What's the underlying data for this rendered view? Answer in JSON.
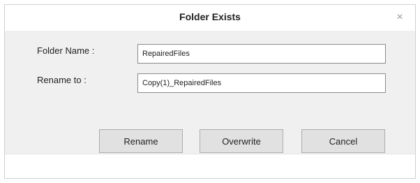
{
  "dialog": {
    "title": "Folder Exists",
    "close_icon": "close-icon",
    "close_glyph": "×"
  },
  "form": {
    "folder_name_label": "Folder Name :",
    "folder_name_value": "RepairedFiles",
    "rename_to_label": "Rename to :",
    "rename_to_value": "Copy(1)_RepairedFiles"
  },
  "buttons": {
    "rename": "Rename",
    "overwrite": "Overwrite",
    "cancel": "Cancel"
  },
  "colors": {
    "dialog_body": "#f0f0f0",
    "titlebar": "#ffffff",
    "button_face": "#e1e1e1",
    "button_border": "#adadad",
    "field_border": "#8a8a8a"
  }
}
